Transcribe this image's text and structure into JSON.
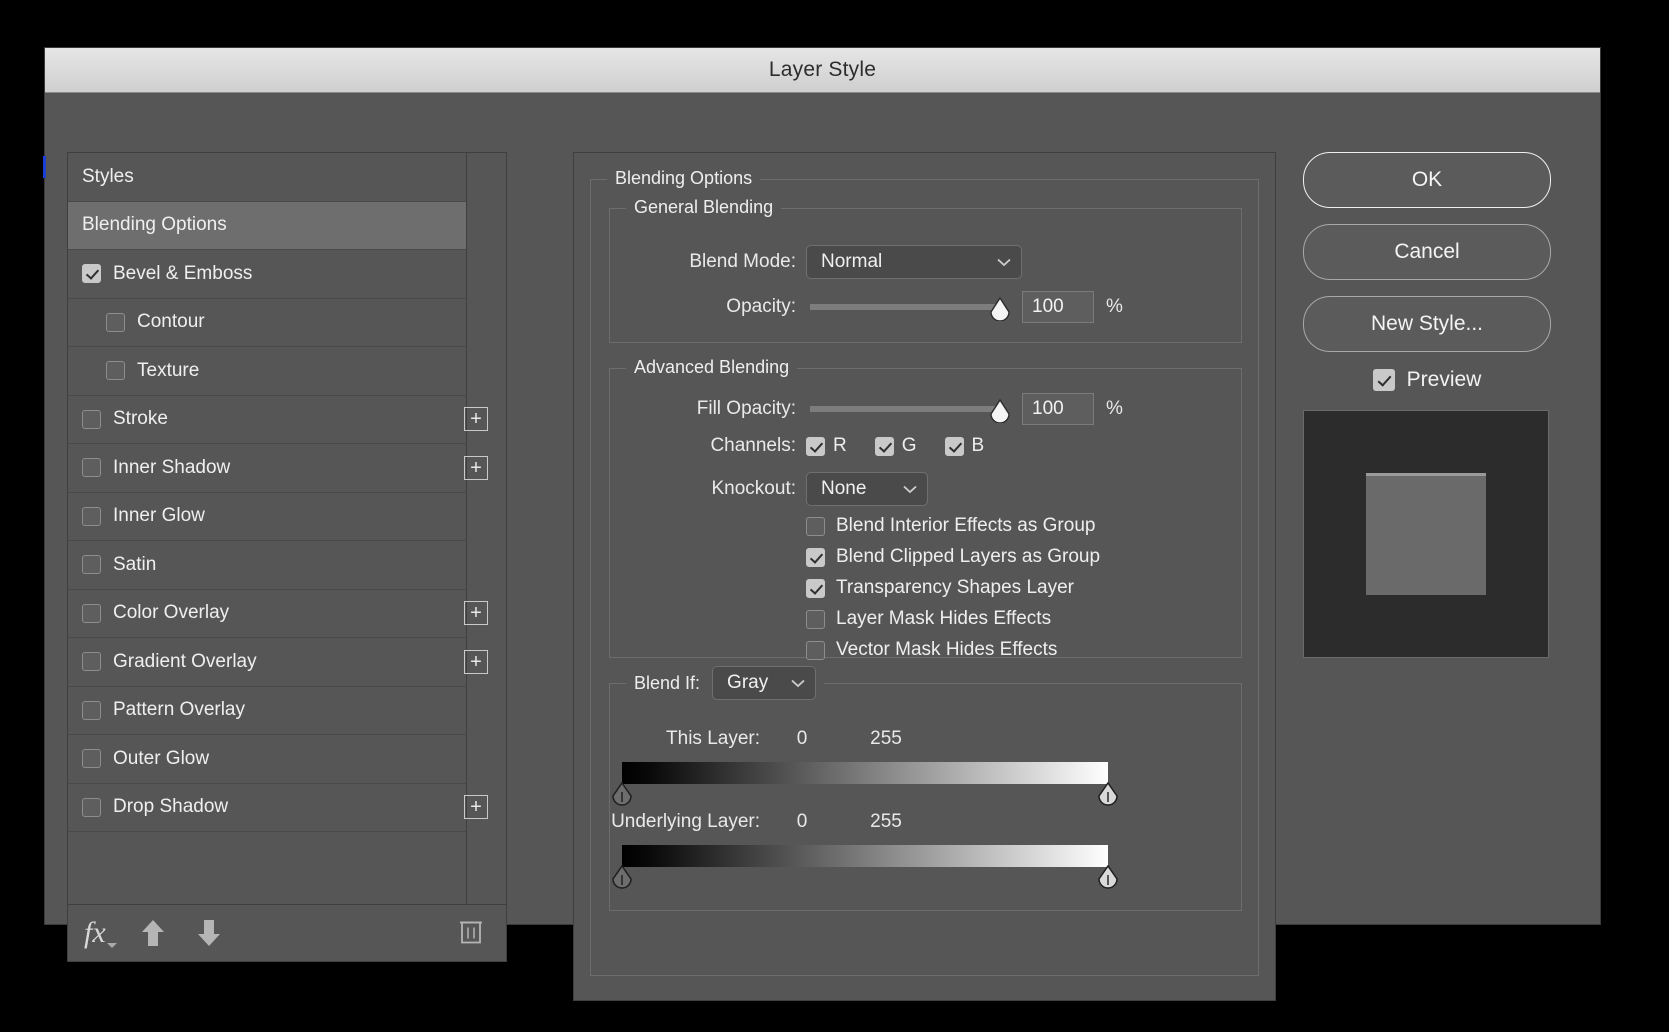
{
  "window": {
    "title": "Layer Style"
  },
  "styles_panel": {
    "items": [
      {
        "label": "Styles",
        "type": "header",
        "checked": null,
        "indent": false,
        "plus": false,
        "selected": false
      },
      {
        "label": "Blending Options",
        "type": "header",
        "checked": null,
        "indent": false,
        "plus": false,
        "selected": true
      },
      {
        "label": "Bevel & Emboss",
        "type": "effect",
        "checked": true,
        "indent": false,
        "plus": false,
        "selected": false
      },
      {
        "label": "Contour",
        "type": "sub",
        "checked": false,
        "indent": true,
        "plus": false,
        "selected": false
      },
      {
        "label": "Texture",
        "type": "sub",
        "checked": false,
        "indent": true,
        "plus": false,
        "selected": false
      },
      {
        "label": "Stroke",
        "type": "effect",
        "checked": false,
        "indent": false,
        "plus": true,
        "selected": false
      },
      {
        "label": "Inner Shadow",
        "type": "effect",
        "checked": false,
        "indent": false,
        "plus": true,
        "selected": false
      },
      {
        "label": "Inner Glow",
        "type": "effect",
        "checked": false,
        "indent": false,
        "plus": false,
        "selected": false
      },
      {
        "label": "Satin",
        "type": "effect",
        "checked": false,
        "indent": false,
        "plus": false,
        "selected": false
      },
      {
        "label": "Color Overlay",
        "type": "effect",
        "checked": false,
        "indent": false,
        "plus": true,
        "selected": false
      },
      {
        "label": "Gradient Overlay",
        "type": "effect",
        "checked": false,
        "indent": false,
        "plus": true,
        "selected": false
      },
      {
        "label": "Pattern Overlay",
        "type": "effect",
        "checked": false,
        "indent": false,
        "plus": false,
        "selected": false
      },
      {
        "label": "Outer Glow",
        "type": "effect",
        "checked": false,
        "indent": false,
        "plus": false,
        "selected": false
      },
      {
        "label": "Drop Shadow",
        "type": "effect",
        "checked": false,
        "indent": false,
        "plus": true,
        "selected": false
      }
    ],
    "toolbar": {
      "fx_label": "fx",
      "move_up_icon": "arrow-up-icon",
      "move_down_icon": "arrow-down-icon",
      "delete_icon": "trash-icon"
    }
  },
  "blending_options": {
    "legend": "Blending Options",
    "general": {
      "legend": "General Blending",
      "blend_mode_label": "Blend Mode:",
      "blend_mode_value": "Normal",
      "opacity_label": "Opacity:",
      "opacity_value": "100",
      "opacity_unit": "%",
      "opacity_percent": 100
    },
    "advanced": {
      "legend": "Advanced Blending",
      "fill_opacity_label": "Fill Opacity:",
      "fill_opacity_value": "100",
      "fill_opacity_unit": "%",
      "fill_opacity_percent": 100,
      "channels_label": "Channels:",
      "channels": [
        {
          "label": "R",
          "checked": true
        },
        {
          "label": "G",
          "checked": true
        },
        {
          "label": "B",
          "checked": true
        }
      ],
      "knockout_label": "Knockout:",
      "knockout_value": "None",
      "checkboxes": [
        {
          "label": "Blend Interior Effects as Group",
          "checked": false
        },
        {
          "label": "Blend Clipped Layers as Group",
          "checked": true
        },
        {
          "label": "Transparency Shapes Layer",
          "checked": true
        },
        {
          "label": "Layer Mask Hides Effects",
          "checked": false
        },
        {
          "label": "Vector Mask Hides Effects",
          "checked": false
        }
      ]
    },
    "blend_if": {
      "legend": "Blend If:",
      "channel_value": "Gray",
      "this_layer": {
        "label": "This Layer:",
        "min": "0",
        "max": "255"
      },
      "underlying_layer": {
        "label": "Underlying Layer:",
        "min": "0",
        "max": "255"
      }
    }
  },
  "actions": {
    "ok_label": "OK",
    "cancel_label": "Cancel",
    "new_style_label": "New Style...",
    "preview_label": "Preview",
    "preview_checked": true
  },
  "colors": {
    "dialog_bg": "#565656",
    "titlebar_top": "#e6e6e6",
    "selected_row": "#6e6e6e",
    "accent_sliver": "#1b3fd6",
    "text": "#efefef",
    "thumb_bg": "#2c2c2c",
    "thumb_square": "#6a6a6a"
  }
}
